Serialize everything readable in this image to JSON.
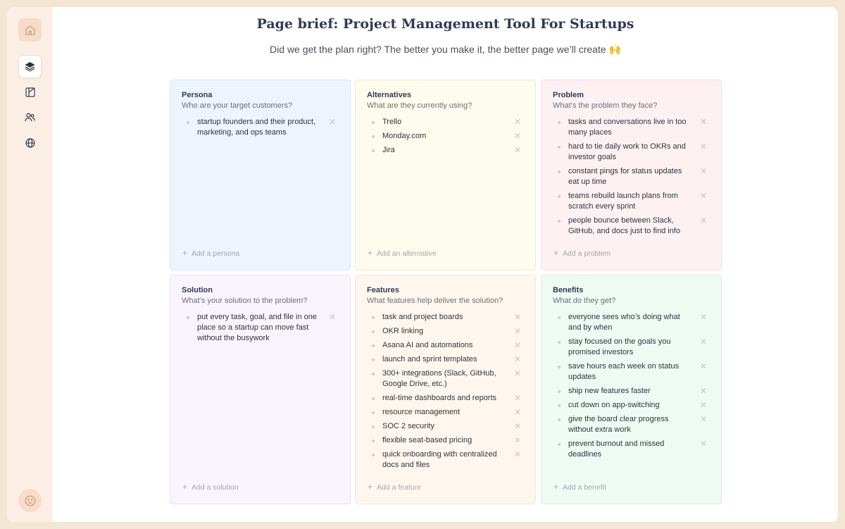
{
  "page": {
    "title": "Page brief: Project Management Tool For Startups",
    "subtitle": "Did we get the plan right? The better you make it, the better page we’ll create 🙌"
  },
  "sidebar": {
    "icons": [
      "home-icon",
      "layers-icon",
      "layout-icon",
      "users-icon",
      "globe-icon",
      "smile-icon"
    ]
  },
  "cards": {
    "persona": {
      "title": "Persona",
      "question": "Who are your target customers?",
      "items": [
        "startup founders and their product, marketing, and ops teams"
      ],
      "add_label": "Add a persona"
    },
    "alternatives": {
      "title": "Alternatives",
      "question": "What are they currently using?",
      "items": [
        "Trello",
        "Monday.com",
        "Jira"
      ],
      "add_label": "Add an alternative"
    },
    "problem": {
      "title": "Problem",
      "question": "What’s the problem they face?",
      "items": [
        "tasks and conversations live in too many places",
        "hard to tie daily work to OKRs and investor goals",
        "constant pings for status updates eat up time",
        "teams rebuild launch plans from scratch every sprint",
        "people bounce between Slack, GitHub, and docs just to find info"
      ],
      "add_label": "Add a problem"
    },
    "solution": {
      "title": "Solution",
      "question": "What’s your solution to the problem?",
      "items": [
        "put every task, goal, and file in one place so a startup can move fast without the busywork"
      ],
      "add_label": "Add a solution"
    },
    "features": {
      "title": "Features",
      "question": "What features help deliver the solution?",
      "items": [
        "task and project boards",
        "OKR linking",
        "Asana AI and automations",
        "launch and sprint templates",
        "300+ integrations (Slack, GitHub, Google Drive, etc.)",
        "real-time dashboards and reports",
        "resource management",
        "SOC 2 security",
        "flexible seat-based pricing",
        "quick onboarding with centralized docs and files"
      ],
      "add_label": "Add a feature"
    },
    "benefits": {
      "title": "Benefits",
      "question": "What do they get?",
      "items": [
        "everyone sees who’s doing what and by when",
        "stay focused on the goals you promised investors",
        "save hours each week on status updates",
        "ship new features faster",
        "cut down on app-switching",
        "give the board clear progress without extra work",
        "prevent burnout and missed deadlines"
      ],
      "add_label": "Add a benefit"
    }
  }
}
